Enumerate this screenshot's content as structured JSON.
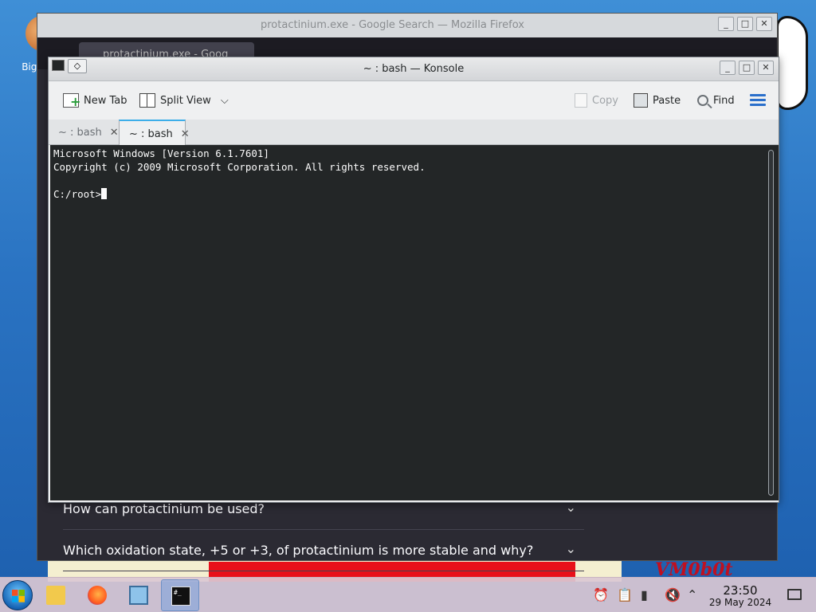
{
  "desktop": {
    "icon_label": "Big De"
  },
  "firefox": {
    "title": "protactinium.exe - Google Search — Mozilla Firefox",
    "tab_title": "protactinium.exe - Goog",
    "faq": [
      "How can protactinium be used?",
      "Which oxidation state, +5 or +3, of protactinium is more stable and why?"
    ]
  },
  "wallpaper": {
    "logo_text": "VM0b0t"
  },
  "konsole": {
    "title": "~ : bash — Konsole",
    "toolbar": {
      "new_tab": "New Tab",
      "split_view": "Split View",
      "copy": "Copy",
      "paste": "Paste",
      "find": "Find"
    },
    "tabs": [
      {
        "label": "~ : bash",
        "active": false
      },
      {
        "label": "~ : bash",
        "active": true
      }
    ],
    "terminal_lines": [
      "Microsoft Windows [Version 6.1.7601]",
      "Copyright (c) 2009 Microsoft Corporation. All rights reserved.",
      "",
      "C:/root>"
    ]
  },
  "taskbar": {
    "term_glyph": "#_",
    "clock_time": "23:50",
    "clock_date": "29 May 2024"
  },
  "icons": {
    "start": "windows-start-icon",
    "folder": "folder-icon",
    "firefox": "firefox-icon",
    "monitor": "monitor-icon",
    "terminal": "terminal-icon",
    "tray": [
      "alarm-icon",
      "clipboard-icon",
      "battery-icon",
      "volume-muted-icon",
      "chevron-up-icon"
    ]
  },
  "colors": {
    "terminal_bg": "#232627",
    "terminal_fg": "#fcfcfc",
    "accent": "#3daee9",
    "firefox_bg": "#2b2a33"
  }
}
